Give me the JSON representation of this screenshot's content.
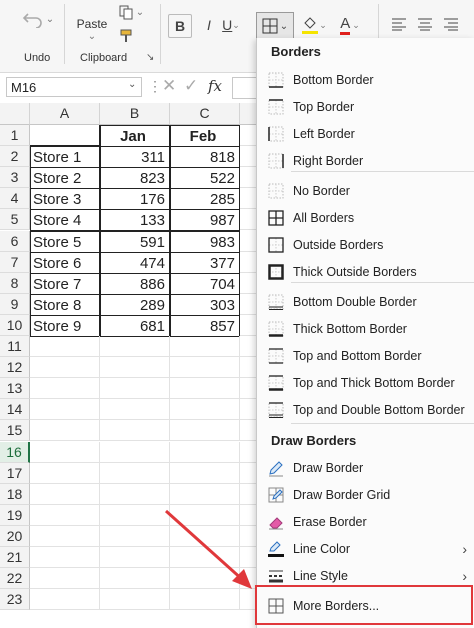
{
  "ribbon": {
    "undo_label": "Undo",
    "paste_label": "Paste",
    "clipboard_label": "Clipboard",
    "bold": "B",
    "italic": "I",
    "underline": "U",
    "font_color": "A"
  },
  "formula_bar": {
    "name_box": "M16",
    "fx": "fx"
  },
  "sheet": {
    "columns": [
      "A",
      "B",
      "C"
    ],
    "rows": [
      [
        "",
        "Jan",
        "Feb"
      ],
      [
        "Store 1",
        "311",
        "818"
      ],
      [
        "Store 2",
        "823",
        "522"
      ],
      [
        "Store 3",
        "176",
        "285"
      ],
      [
        "Store 4",
        "133",
        "987"
      ],
      [
        "Store 5",
        "591",
        "983"
      ],
      [
        "Store 6",
        "474",
        "377"
      ],
      [
        "Store 7",
        "886",
        "704"
      ],
      [
        "Store 8",
        "289",
        "303"
      ],
      [
        "Store 9",
        "681",
        "857"
      ]
    ],
    "row_numbers": [
      "1",
      "2",
      "3",
      "4",
      "5",
      "6",
      "7",
      "8",
      "9",
      "10",
      "11",
      "12",
      "13",
      "14",
      "15",
      "16",
      "17",
      "18",
      "19",
      "20",
      "21",
      "22",
      "23"
    ],
    "selected_row": "16"
  },
  "menu": {
    "borders_heading": "Borders",
    "items": [
      {
        "label": "Bottom Border",
        "icon": "bottom-border-icon"
      },
      {
        "label": "Top Border",
        "icon": "top-border-icon"
      },
      {
        "label": "Left Border",
        "icon": "left-border-icon"
      },
      {
        "label": "Right Border",
        "icon": "right-border-icon"
      },
      {
        "label": "No Border",
        "icon": "no-border-icon"
      },
      {
        "label": "All Borders",
        "icon": "all-borders-icon"
      },
      {
        "label": "Outside Borders",
        "icon": "outside-borders-icon"
      },
      {
        "label": "Thick Outside Borders",
        "icon": "thick-outside-borders-icon"
      },
      {
        "label": "Bottom Double Border",
        "icon": "bottom-double-border-icon"
      },
      {
        "label": "Thick Bottom Border",
        "icon": "thick-bottom-border-icon"
      },
      {
        "label": "Top and Bottom Border",
        "icon": "top-bottom-border-icon"
      },
      {
        "label": "Top and Thick Bottom Border",
        "icon": "top-thick-bottom-border-icon"
      },
      {
        "label": "Top and Double Bottom Border",
        "icon": "top-double-bottom-border-icon"
      }
    ],
    "draw_heading": "Draw Borders",
    "draw_items": [
      {
        "label": "Draw Border",
        "icon": "pencil-icon"
      },
      {
        "label": "Draw Border Grid",
        "icon": "pencil-grid-icon"
      },
      {
        "label": "Erase Border",
        "icon": "eraser-icon"
      },
      {
        "label": "Line Color",
        "icon": "line-color-icon"
      },
      {
        "label": "Line Style",
        "icon": "line-style-icon"
      }
    ],
    "more_borders": "More Borders...",
    "accent_color": "#e0383b",
    "selection_color": "#217346"
  }
}
